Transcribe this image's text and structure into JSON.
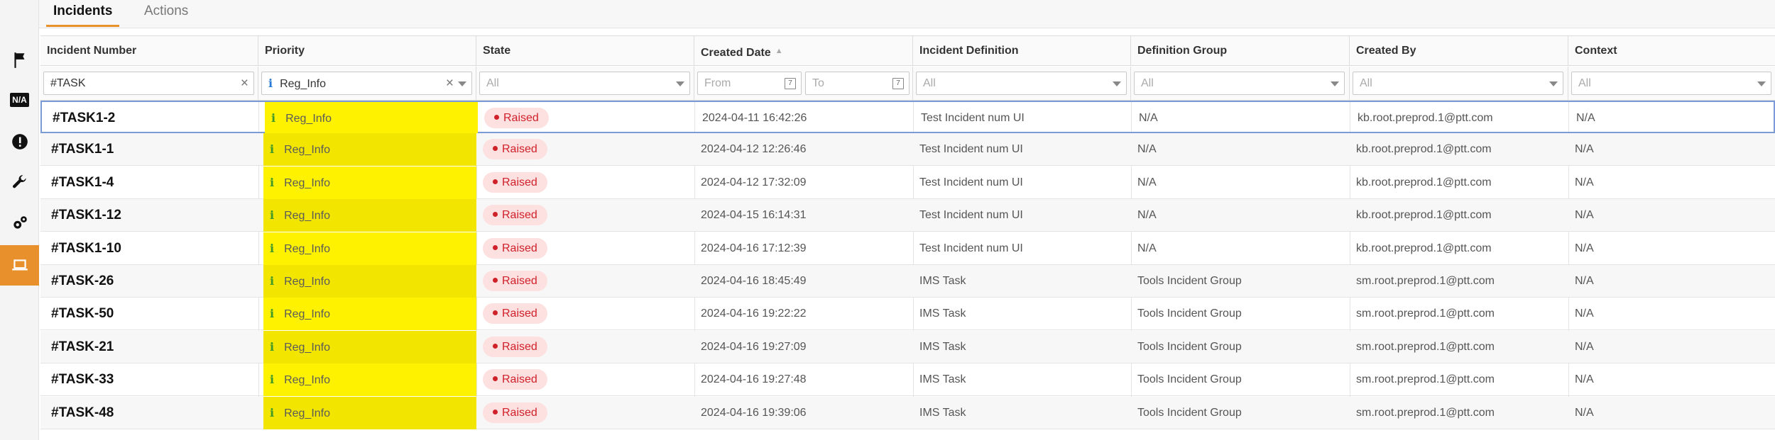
{
  "tabs": [
    {
      "label": "Incidents",
      "active": true
    },
    {
      "label": "Actions",
      "active": false
    }
  ],
  "sidebar": {
    "items": [
      {
        "icon": "flag-icon"
      },
      {
        "icon": "na-icon",
        "text": "N/A"
      },
      {
        "icon": "alert-icon"
      },
      {
        "icon": "wrench-icon"
      },
      {
        "icon": "gears-icon"
      },
      {
        "icon": "laptop-icon",
        "active": true
      }
    ]
  },
  "colors": {
    "accent": "#e8912c",
    "priority_bg": "#fff200",
    "raised_text": "#d0202a",
    "raised_bg": "#fde0e0",
    "selected_border": "#7b9bd6"
  },
  "columns": [
    "Incident Number",
    "Priority",
    "State",
    "Created Date",
    "Incident Definition",
    "Definition Group",
    "Created By",
    "Context"
  ],
  "sort_indicator": "▲",
  "filters": {
    "incident_number": "#TASK",
    "priority": "Reg_Info",
    "state": "All",
    "date_from": "From",
    "date_to": "To",
    "definition": "All",
    "group": "All",
    "created_by": "All",
    "context": "All",
    "clear": "×",
    "cal_day": "7"
  },
  "rows": [
    {
      "number": "#TASK1-2",
      "priority": "Reg_Info",
      "state": "Raised",
      "created": "2024-04-11 16:42:26",
      "definition": "Test Incident num UI",
      "group": "N/A",
      "by": "kb.root.preprod.1@ptt.com",
      "context": "N/A"
    },
    {
      "number": "#TASK1-1",
      "priority": "Reg_Info",
      "state": "Raised",
      "created": "2024-04-12 12:26:46",
      "definition": "Test Incident num UI",
      "group": "N/A",
      "by": "kb.root.preprod.1@ptt.com",
      "context": "N/A"
    },
    {
      "number": "#TASK1-4",
      "priority": "Reg_Info",
      "state": "Raised",
      "created": "2024-04-12 17:32:09",
      "definition": "Test Incident num UI",
      "group": "N/A",
      "by": "kb.root.preprod.1@ptt.com",
      "context": "N/A"
    },
    {
      "number": "#TASK1-12",
      "priority": "Reg_Info",
      "state": "Raised",
      "created": "2024-04-15 16:14:31",
      "definition": "Test Incident num UI",
      "group": "N/A",
      "by": "kb.root.preprod.1@ptt.com",
      "context": "N/A"
    },
    {
      "number": "#TASK1-10",
      "priority": "Reg_Info",
      "state": "Raised",
      "created": "2024-04-16 17:12:39",
      "definition": "Test Incident num UI",
      "group": "N/A",
      "by": "kb.root.preprod.1@ptt.com",
      "context": "N/A"
    },
    {
      "number": "#TASK-26",
      "priority": "Reg_Info",
      "state": "Raised",
      "created": "2024-04-16 18:45:49",
      "definition": "IMS Task",
      "group": "Tools Incident Group",
      "by": "sm.root.preprod.1@ptt.com",
      "context": "N/A"
    },
    {
      "number": "#TASK-50",
      "priority": "Reg_Info",
      "state": "Raised",
      "created": "2024-04-16 19:22:22",
      "definition": "IMS Task",
      "group": "Tools Incident Group",
      "by": "sm.root.preprod.1@ptt.com",
      "context": "N/A"
    },
    {
      "number": "#TASK-21",
      "priority": "Reg_Info",
      "state": "Raised",
      "created": "2024-04-16 19:27:09",
      "definition": "IMS Task",
      "group": "Tools Incident Group",
      "by": "sm.root.preprod.1@ptt.com",
      "context": "N/A"
    },
    {
      "number": "#TASK-33",
      "priority": "Reg_Info",
      "state": "Raised",
      "created": "2024-04-16 19:27:48",
      "definition": "IMS Task",
      "group": "Tools Incident Group",
      "by": "sm.root.preprod.1@ptt.com",
      "context": "N/A"
    },
    {
      "number": "#TASK-48",
      "priority": "Reg_Info",
      "state": "Raised",
      "created": "2024-04-16 19:39:06",
      "definition": "IMS Task",
      "group": "Tools Incident Group",
      "by": "sm.root.preprod.1@ptt.com",
      "context": "N/A"
    }
  ]
}
